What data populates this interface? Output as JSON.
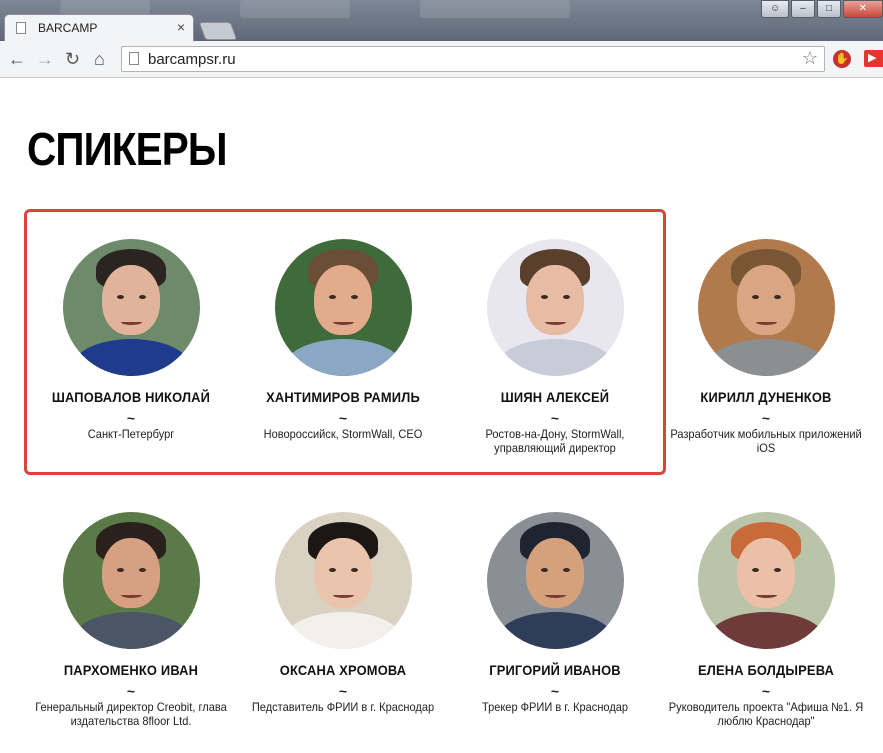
{
  "browser": {
    "tab_title": "BARCAMP",
    "tab_close": "×",
    "url": "barcampsr.ru"
  },
  "page": {
    "heading": "СПИКЕРЫ"
  },
  "speakers": [
    {
      "name": "ШАПОВАЛОВ НИКОЛАЙ",
      "sep": "~",
      "desc": "Санкт-Петербург",
      "bg": "#6d8a6a",
      "skin": "#e1b39a",
      "hair": "#2b2420",
      "shirt": "#1f3c8c"
    },
    {
      "name": "ХАНТИМИРОВ РАМИЛЬ",
      "sep": "~",
      "desc": "Новороссийск, StormWall, CEO",
      "bg": "#3f6b3a",
      "skin": "#e2ab8c",
      "hair": "#6a4e35",
      "shirt": "#8aa7c4"
    },
    {
      "name": "ШИЯН АЛЕКСЕЙ",
      "sep": "~",
      "desc": "Ростов-на-Дону, StormWall, управляющий директор",
      "bg": "#e8e6ef",
      "skin": "#e8bba4",
      "hair": "#5a3f2c",
      "shirt": "#c8ccd8"
    },
    {
      "name": "КИРИЛЛ ДУНЕНКОВ",
      "sep": "~",
      "desc": "Разработчик мобильных приложений iOS",
      "bg": "#b07a4c",
      "skin": "#d9a582",
      "hair": "#7a5636",
      "shirt": "#8c8f92"
    },
    {
      "name": "ПАРХОМЕНКО ИВАН",
      "sep": "~",
      "desc": "Генеральный директор Creobit, глава издательства 8floor Ltd.",
      "bg": "#5a7a48",
      "skin": "#d7a083",
      "hair": "#2a211c",
      "shirt": "#4a5566"
    },
    {
      "name": "ОКСАНА ХРОМОВА",
      "sep": "~",
      "desc": "Педставитель ФРИИ в г. Краснодар",
      "bg": "#d9d2c2",
      "skin": "#eac4ad",
      "hair": "#1c1614",
      "shirt": "#f3f0ea"
    },
    {
      "name": "ГРИГОРИЙ ИВАНОВ",
      "sep": "~",
      "desc": "Трекер ФРИИ в г. Краснодар",
      "bg": "#8a8e95",
      "skin": "#d5a07c",
      "hair": "#1e2430",
      "shirt": "#2f3d5a"
    },
    {
      "name": "ЕЛЕНА БОЛДЫРЕВА",
      "sep": "~",
      "desc": "Руководитель проекта \"Афиша №1. Я люблю Краснодар\"",
      "bg": "#b9c4a8",
      "skin": "#ecc0a6",
      "hair": "#c96a3a",
      "shirt": "#6e3a3a"
    }
  ]
}
